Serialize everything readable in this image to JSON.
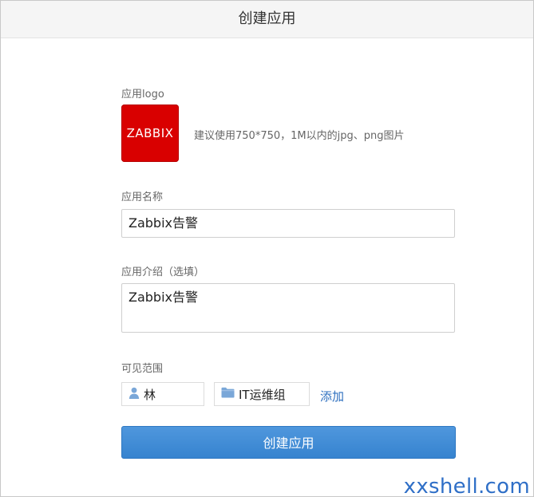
{
  "header": {
    "title": "创建应用"
  },
  "logo_section": {
    "label": "应用logo",
    "logo_text": "ZABBIX",
    "hint": "建议使用750*750，1M以内的jpg、png图片",
    "logo_color": "#d90000"
  },
  "name_section": {
    "label": "应用名称",
    "value": "Zabbix告警"
  },
  "intro_section": {
    "label": "应用介绍（选填）",
    "value": "Zabbix告警"
  },
  "visibility_section": {
    "label": "可见范围",
    "user_chip": {
      "icon": "user-icon",
      "text": "林"
    },
    "group_chip": {
      "icon": "folder-icon",
      "text": "IT运维组"
    },
    "add_label": "添加"
  },
  "submit": {
    "label": "创建应用",
    "color": "#3a88d4"
  },
  "watermark": {
    "text": "xxshell.com"
  }
}
